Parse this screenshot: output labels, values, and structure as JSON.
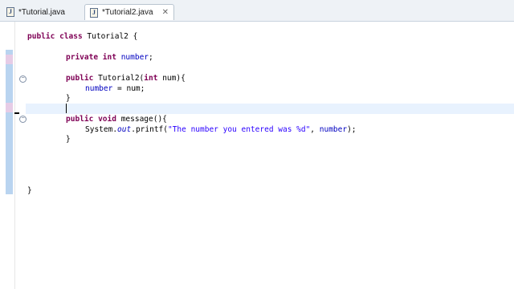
{
  "tabs": [
    {
      "label": "*Tutorial.java",
      "icon": "java-file-icon",
      "active": false
    },
    {
      "label": "*Tutorial2.java",
      "icon": "java-file-icon",
      "active": true
    }
  ],
  "code": {
    "class_decl": "Tutorial2",
    "field_type": "int",
    "field_name": "number",
    "ctor_name": "Tutorial2",
    "ctor_param": "num",
    "method_name": "message",
    "printf_string": "\"The number you entered was %d\"",
    "printf_arg": "number"
  },
  "colors": {
    "keyword": "#7f0055",
    "field": "#0000c0",
    "string": "#2a00ff",
    "current_line": "#e8f2fe"
  }
}
